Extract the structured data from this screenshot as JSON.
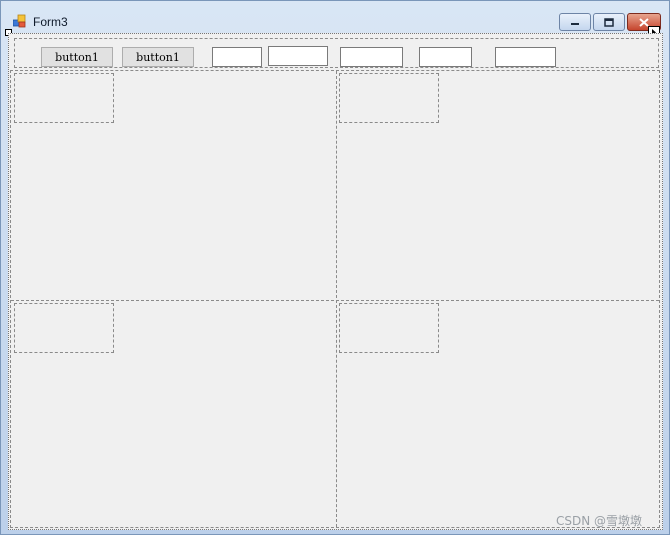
{
  "window": {
    "title": "Form3",
    "icon": "form-app-icon",
    "controls": {
      "minimize_icon": "minimize-icon",
      "maximize_icon": "maximize-icon",
      "close_icon": "close-icon"
    }
  },
  "toolbar": {
    "buttons": [
      {
        "label": "button1"
      },
      {
        "label": "button1"
      }
    ],
    "textboxes": [
      {
        "value": ""
      },
      {
        "value": ""
      },
      {
        "value": ""
      },
      {
        "value": ""
      },
      {
        "value": ""
      }
    ]
  },
  "watermark": "CSDN @雪墩墩"
}
